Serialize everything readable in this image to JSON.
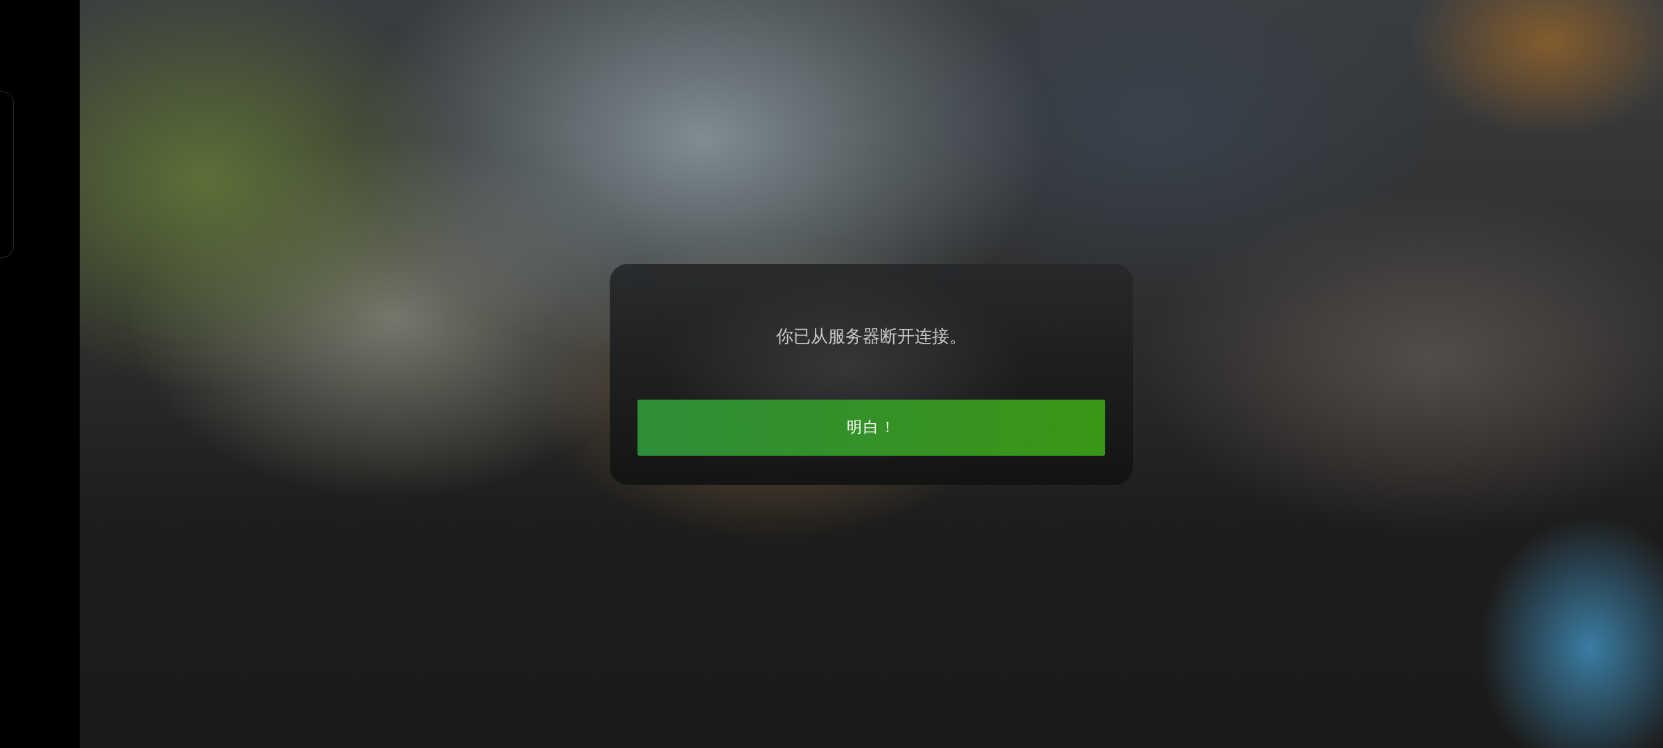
{
  "dialog": {
    "message": "你已从服务器断开连接。",
    "button": "明白！"
  }
}
